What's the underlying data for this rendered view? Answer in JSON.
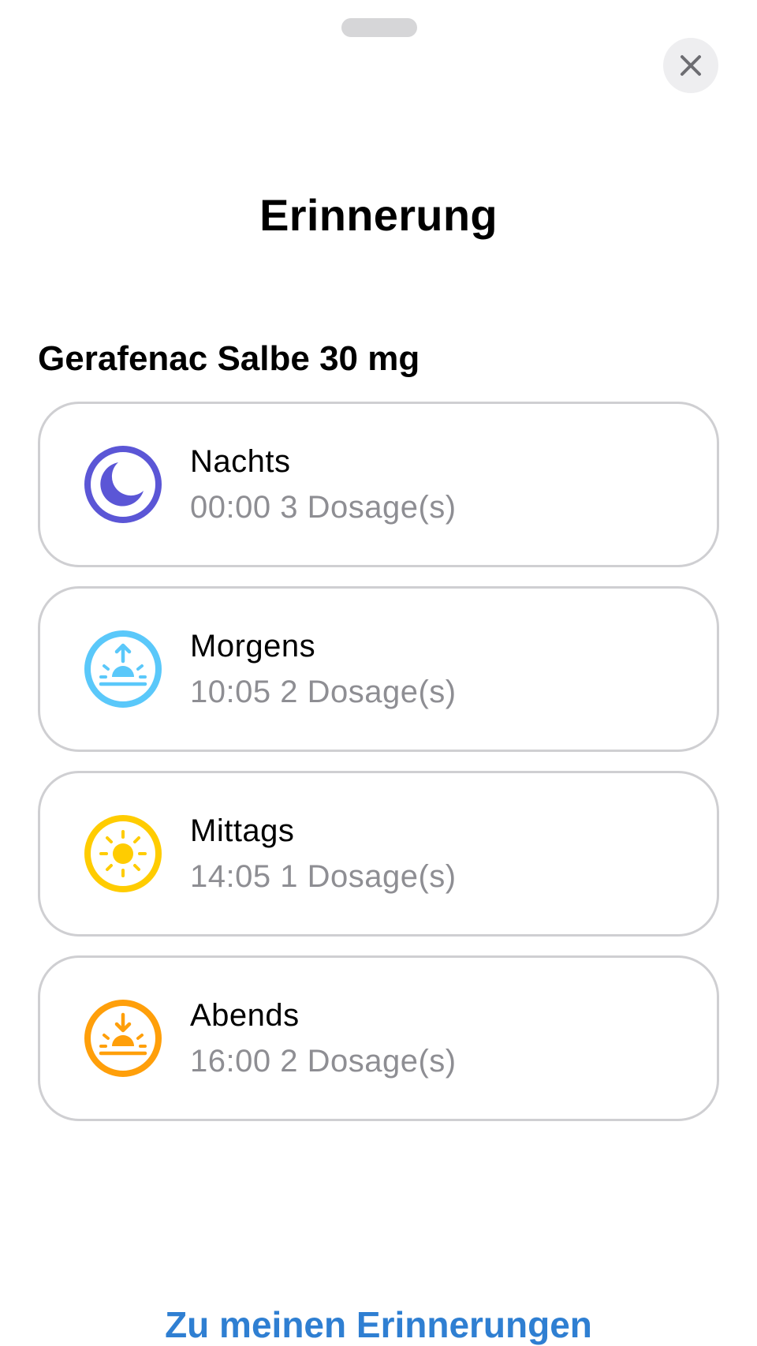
{
  "sheet": {
    "title": "Erinnerung",
    "medication_name": "Gerafenac Salbe 30 mg"
  },
  "reminders": [
    {
      "period": "Nachts",
      "detail": "00:00 3 Dosage(s)",
      "icon": "moon-icon",
      "color": "#5b56d6"
    },
    {
      "period": "Morgens",
      "detail": "10:05 2 Dosage(s)",
      "icon": "sunrise-icon",
      "color": "#5ac8fa"
    },
    {
      "period": "Mittags",
      "detail": "14:05 1 Dosage(s)",
      "icon": "sun-icon",
      "color": "#ffcc00"
    },
    {
      "period": "Abends",
      "detail": "16:00 2 Dosage(s)",
      "icon": "sunset-icon",
      "color": "#ff9f0a"
    }
  ],
  "footer": {
    "link_label": "Zu meinen Erinnerungen",
    "link_color": "#2f7fd2"
  }
}
